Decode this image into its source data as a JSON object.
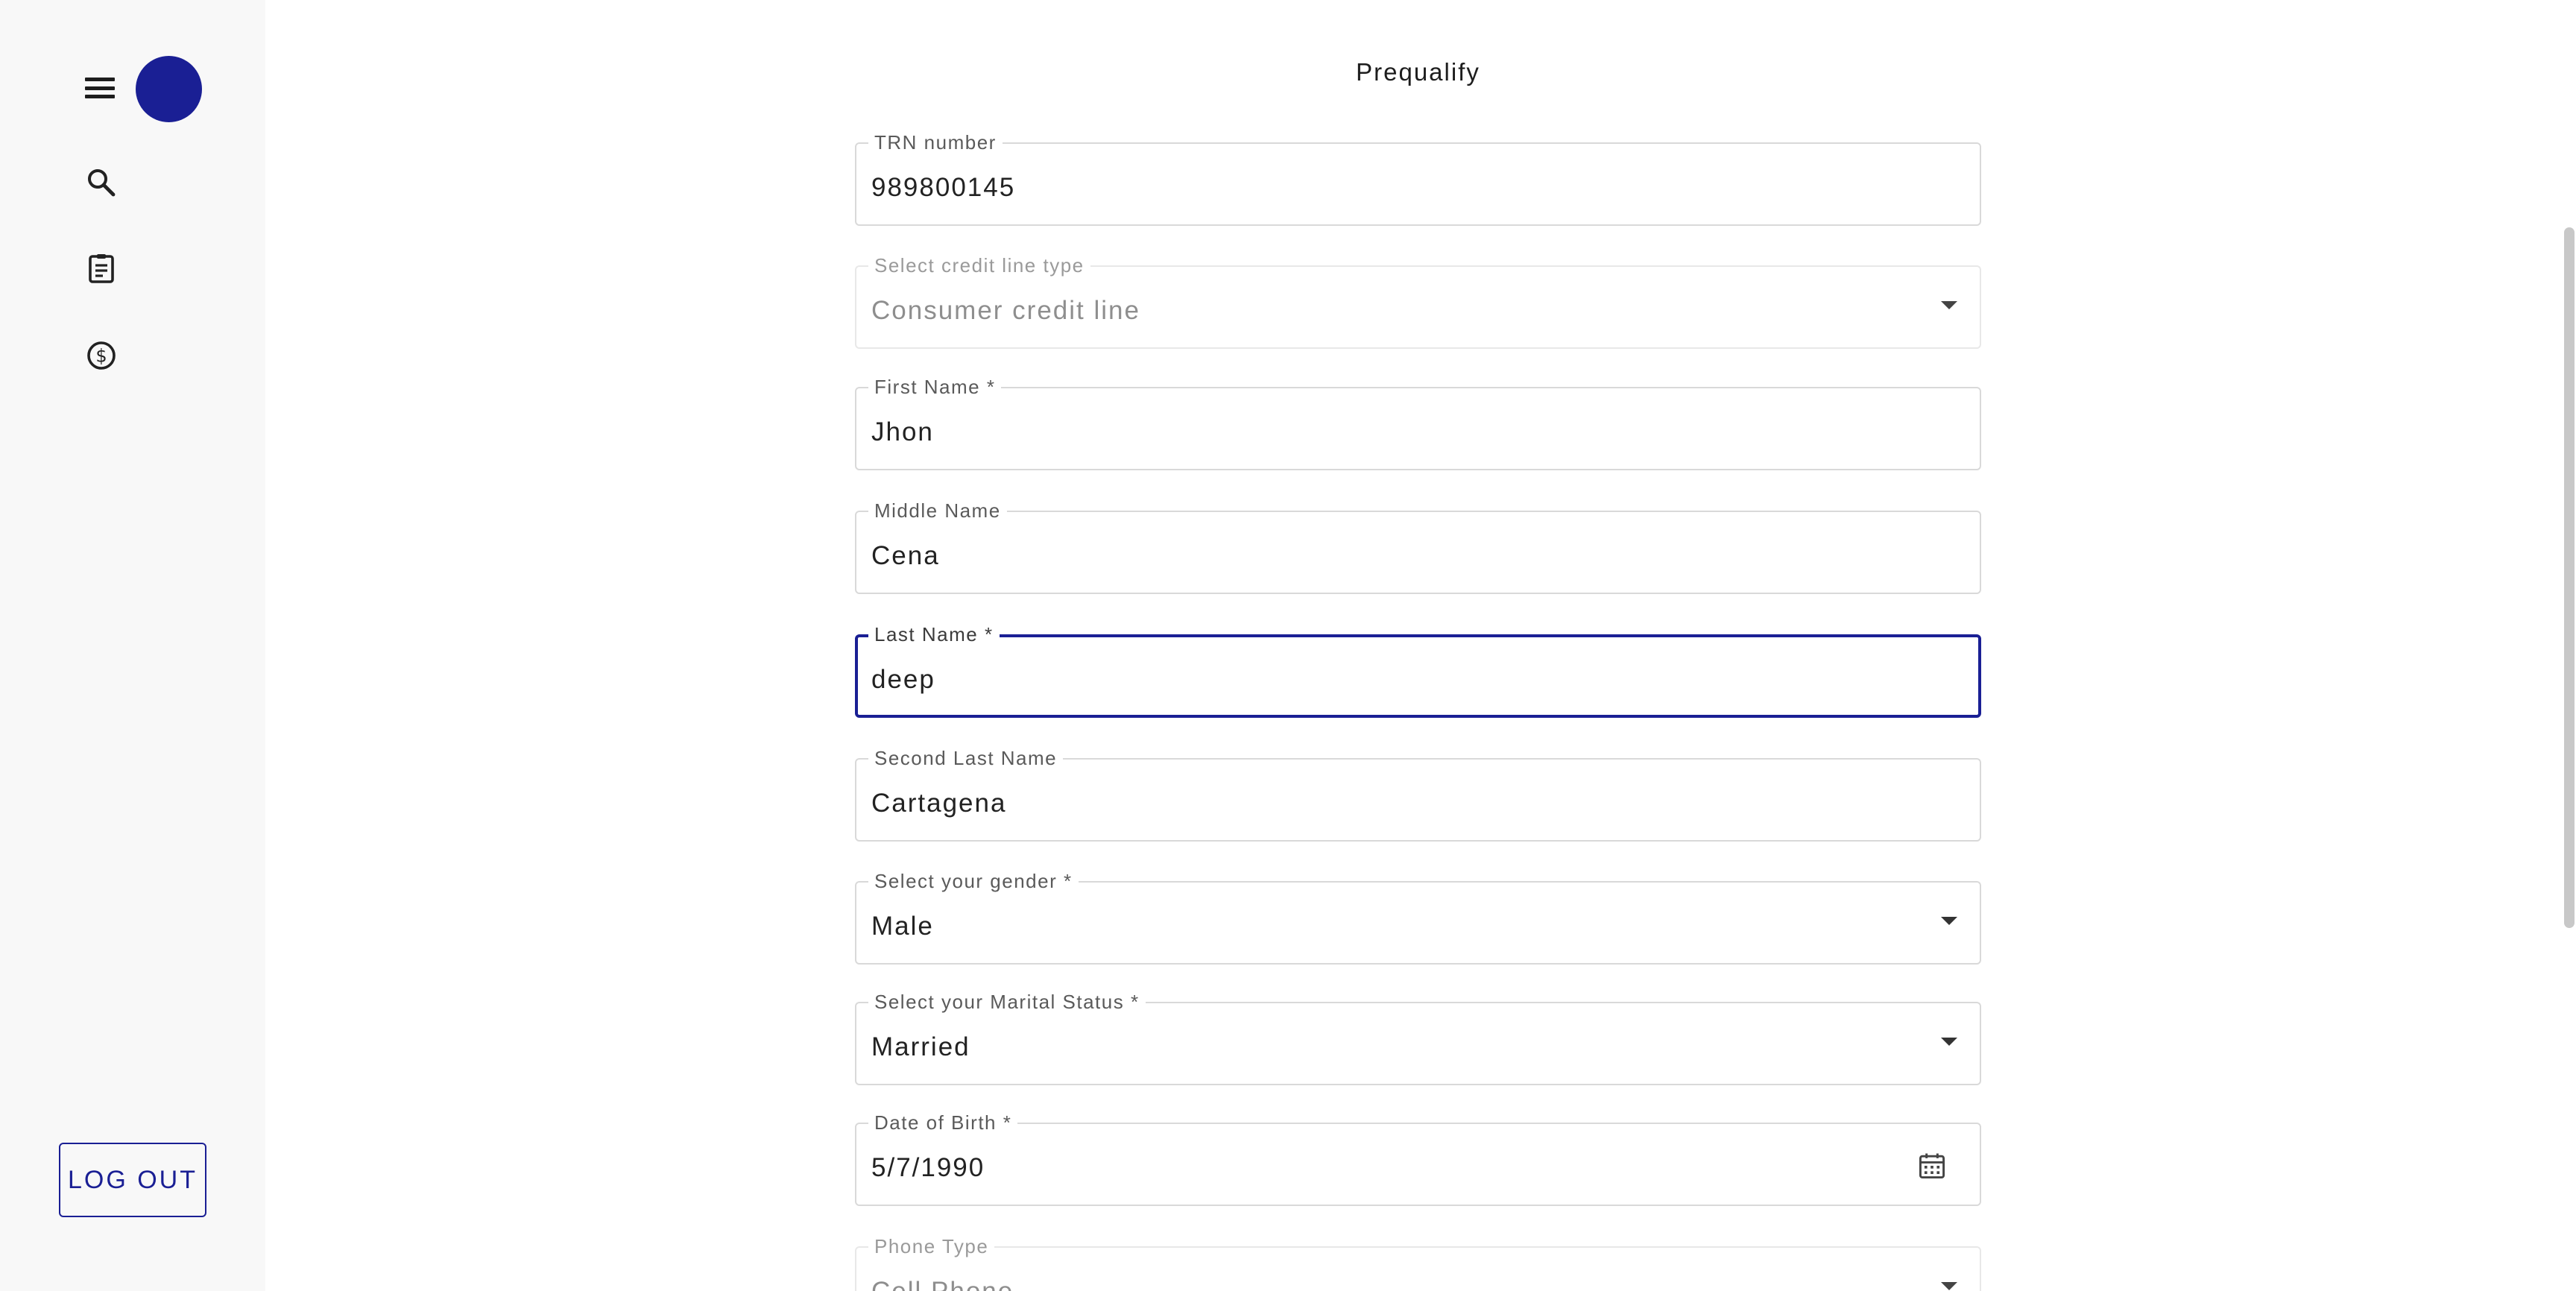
{
  "sidebar": {
    "icons": [
      "menu-icon",
      "search-icon",
      "clipboard-icon",
      "dollar-icon"
    ],
    "avatar_color": "#1a1f94",
    "logout_label": "LOG OUT"
  },
  "main": {
    "title": "Prequalify",
    "fields": {
      "trn": {
        "label": "TRN number",
        "value": "989800145"
      },
      "credit_line": {
        "label": "Select credit line type",
        "value": "Consumer credit line"
      },
      "first_name": {
        "label": "First Name *",
        "value": "Jhon"
      },
      "middle_name": {
        "label": "Middle Name",
        "value": "Cena"
      },
      "last_name": {
        "label": "Last Name *",
        "value": "deep"
      },
      "second_last_name": {
        "label": "Second Last Name",
        "value": "Cartagena"
      },
      "gender": {
        "label": "Select your gender *",
        "value": "Male"
      },
      "marital_status": {
        "label": "Select your Marital Status *",
        "value": "Married"
      },
      "dob": {
        "label": "Date of Birth *",
        "value": "5/7/1990"
      },
      "phone_type": {
        "label": "Phone Type",
        "value": "Cell Phone"
      }
    }
  },
  "colors": {
    "accent": "#1a1f94",
    "sidebar_bg": "#f8f8f8",
    "border": "#d9d9d9"
  }
}
